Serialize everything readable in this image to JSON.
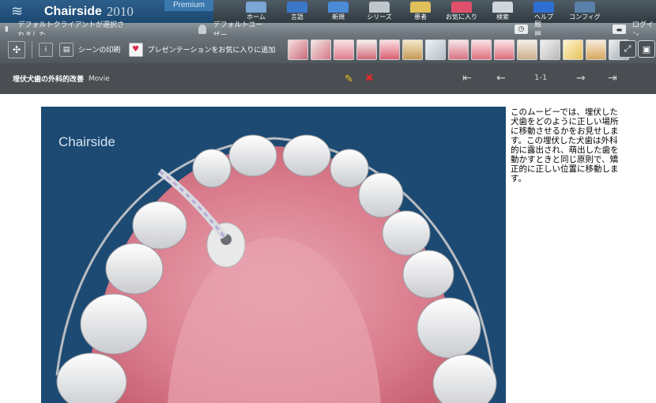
{
  "brand": {
    "name": "Chairside",
    "year": "2010",
    "edition": "Premium",
    "colors": {
      "brand_bg": "#1b4870",
      "edition_bg": "#3a78ad"
    }
  },
  "nav": {
    "items": [
      {
        "label": "ホーム",
        "icon": "home-icon",
        "color": "#7aa7d6"
      },
      {
        "label": "言語",
        "icon": "language-icon",
        "color": "#3b77c8"
      },
      {
        "label": "新規",
        "icon": "new-icon",
        "color": "#4a8bd8"
      },
      {
        "label": "シリーズ",
        "icon": "series-icon",
        "color": "#bfc6cc"
      },
      {
        "label": "患者",
        "icon": "patient-icon",
        "color": "#e0c05a"
      },
      {
        "label": "お気に入り",
        "icon": "favorites-icon",
        "color": "#e0506a"
      },
      {
        "label": "検索",
        "icon": "search-icon",
        "color": "#cfd6dc"
      },
      {
        "label": "ヘルプ",
        "icon": "help-icon",
        "color": "#2d6fd1"
      },
      {
        "label": "コンフィグ",
        "icon": "config-icon",
        "color": "#5a7fa8"
      }
    ]
  },
  "status": {
    "client": "デフォルトクライアントが選択されました",
    "user": "デフォルトユーザー",
    "history": "厩歴",
    "login": "ログイン"
  },
  "toolbar": {
    "print_scene": "シーンの印刷",
    "add_favorite": "プレゼンテーションをお気に入りに追加"
  },
  "scene": {
    "title": "埋伏犬歯の外科的改善",
    "type": "Movie",
    "page": "1-1"
  },
  "video": {
    "logo": "Chairside"
  },
  "description": "このムービーでは、埋伏した犬歯をどのように正しい場所に移動させるかをお見せします。この埋伏した犬歯は外科的に露出され、萌出した歯を動かすときと同じ原則で、矯正的に正しい位置に移動します。"
}
